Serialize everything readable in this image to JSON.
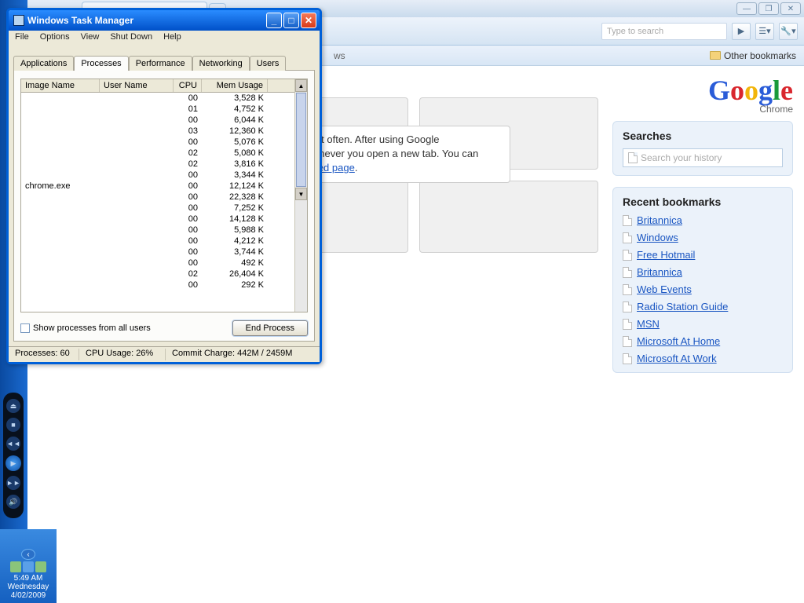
{
  "chrome": {
    "tab_label": "",
    "new_tab_plus": "+",
    "tab_close": "×",
    "win": {
      "min": "—",
      "max": "❐",
      "close": "✕"
    },
    "toolbar": {
      "search_placeholder": "Type to search",
      "go": "▶",
      "page": "☰▾",
      "wrench": "🔧▾"
    },
    "bookbar": {
      "ws": "ws",
      "other": "Other bookmarks"
    },
    "help_text1": "at you use most often. After using Google",
    "help_text2": "sited sites whenever you open a new tab. You can",
    "help_text3": "e ",
    "help_link": "Getting Started page",
    "logo_sub": "Chrome",
    "searches_h": "Searches",
    "search_hist_ph": "Search your history",
    "recent_h": "Recent bookmarks",
    "bookmarks": [
      "Britannica",
      "Windows",
      "Free Hotmail",
      "Britannica",
      "Web Events",
      "Radio Station Guide",
      "MSN",
      "Microsoft At Home",
      "Microsoft At Work"
    ]
  },
  "tm": {
    "title": "Windows Task Manager",
    "menu": [
      "File",
      "Options",
      "View",
      "Shut Down",
      "Help"
    ],
    "tabs": [
      "Applications",
      "Processes",
      "Performance",
      "Networking",
      "Users"
    ],
    "active_tab": 1,
    "columns": {
      "image": "Image Name",
      "user": "User Name",
      "cpu": "CPU",
      "mem": "Mem Usage"
    },
    "rows": [
      {
        "img": "",
        "user": "",
        "cpu": "00",
        "mem": "3,528 K"
      },
      {
        "img": "",
        "user": "",
        "cpu": "01",
        "mem": "4,752 K"
      },
      {
        "img": "",
        "user": "",
        "cpu": "00",
        "mem": "6,044 K"
      },
      {
        "img": "",
        "user": "",
        "cpu": "03",
        "mem": "12,360 K"
      },
      {
        "img": "",
        "user": "",
        "cpu": "00",
        "mem": "5,076 K"
      },
      {
        "img": "",
        "user": "",
        "cpu": "02",
        "mem": "5,080 K"
      },
      {
        "img": "",
        "user": "",
        "cpu": "02",
        "mem": "3,816 K"
      },
      {
        "img": "",
        "user": "",
        "cpu": "00",
        "mem": "3,344 K"
      },
      {
        "img": "chrome.exe",
        "user": "",
        "cpu": "00",
        "mem": "12,124 K"
      },
      {
        "img": "",
        "user": "",
        "cpu": "00",
        "mem": "22,328 K"
      },
      {
        "img": "",
        "user": "",
        "cpu": "00",
        "mem": "7,252 K"
      },
      {
        "img": "",
        "user": "",
        "cpu": "00",
        "mem": "14,128 K"
      },
      {
        "img": "",
        "user": "",
        "cpu": "00",
        "mem": "5,988 K"
      },
      {
        "img": "",
        "user": "",
        "cpu": "00",
        "mem": "4,212 K"
      },
      {
        "img": "",
        "user": "",
        "cpu": "00",
        "mem": "3,744 K"
      },
      {
        "img": "",
        "user": "",
        "cpu": "00",
        "mem": "492 K"
      },
      {
        "img": "",
        "user": "",
        "cpu": "02",
        "mem": "26,404 K"
      },
      {
        "img": "",
        "user": "",
        "cpu": "00",
        "mem": "292 K"
      }
    ],
    "show_all": "Show processes from all users",
    "end_btn": "End Process",
    "status": {
      "proc": "Processes: 60",
      "cpu": "CPU Usage: 26%",
      "commit": "Commit Charge: 442M / 2459M"
    },
    "win": {
      "min": "_",
      "max": "□",
      "close": "✕"
    },
    "scroll": {
      "up": "▲",
      "down": "▼"
    }
  },
  "tray": {
    "time": "5:49 AM",
    "day": "Wednesday",
    "date": "4/02/2009",
    "arrow": "‹"
  },
  "media": {
    "prev": "◄◄",
    "play": "▶",
    "next": "►►",
    "stop": "■",
    "vol": "🔊",
    "eject": "⏏"
  }
}
